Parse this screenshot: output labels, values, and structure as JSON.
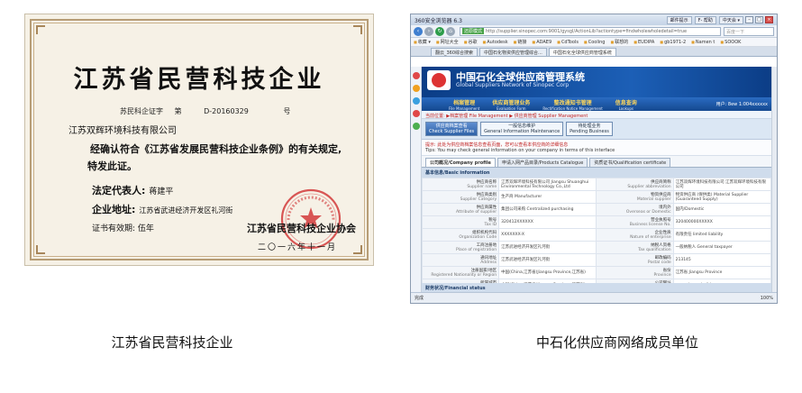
{
  "certificate": {
    "title": "江苏省民营科技企业",
    "number_prefix": "苏民科企证字",
    "number_di": "第",
    "number": "D-20160329",
    "number_suffix": "号",
    "company": "江苏双辉环境科技有限公司",
    "statement_line1": "经确认符合《江苏省发展民营科技企业条例》的有关规定,",
    "statement_line2": "特发此证。",
    "rep_label": "法定代表人:",
    "rep_value": "蒋建平",
    "addr_label": "企业地址:",
    "addr_value": "江苏省武进经济开发区礼河街",
    "valid_label": "证书有效期:",
    "valid_value": "伍年",
    "issuer": "江苏省民营科技企业协会",
    "date": "二〇一六年十一月"
  },
  "captions": {
    "left": "江苏省民营科技企业",
    "right": "中石化供应商网络成员单位"
  },
  "browser": {
    "window_title": "360安全浏览器 6.3",
    "title_badges": [
      "邮件提示",
      "F- 帮助",
      "中天会 ▾"
    ],
    "address_label": "还原模式",
    "url": "http://supplier.sinopec.com:9001/gysgl/ActionLib?actiontype=findwholewholedetail=true",
    "search_placeholder": "百度一下",
    "bookmarks": [
      "收藏 ▾",
      "网址大全",
      "谷歌",
      "Autodesk",
      "链接",
      "ADAE9",
      "CdTools",
      "Cooling",
      "联想的",
      "EUDIPA",
      "gb1971-2",
      "Namen t",
      "SOOOK"
    ],
    "tabs": [
      "翻云_360综合搜索",
      "中国石化物资供应管理综合...",
      "中国石化全球供应商管理系统"
    ],
    "site": {
      "title_cn": "中国石化全球供应商管理系统",
      "title_en": "Global Suppliers Network of Sinopec Corp",
      "menu": [
        {
          "cn": "档案管理",
          "en": "File Management"
        },
        {
          "cn": "供应商管理业务",
          "en": "Evaluation Form"
        },
        {
          "cn": "整改通知书管理",
          "en": "Rectification Notice Management"
        },
        {
          "cn": "信息查询",
          "en": "Lookups"
        }
      ],
      "user": "用户: 8ew 1:004xxxxxx",
      "breadcrumb": "当前位置: ▶档案管理 File Management ▶ 供应商管理 Supplier Management",
      "buttons": [
        {
          "cn": "供应商档案查看",
          "en": "Check Supplier Files",
          "primary": true
        },
        {
          "cn": "一般信息维护",
          "en": "General Information Maintenance",
          "primary": false
        },
        {
          "cn": "待处理业务",
          "en": "Pending Business",
          "primary": false
        }
      ],
      "tip": "提示: 此处为供应商档案信息查看页面，您可以查看本供应商的详细信息",
      "tip2": "Tips: You may check general information on your company in terms of this interface",
      "profile_tabs": [
        "公司概况/Company profile",
        "申请入网产品目录/Products Catalogue",
        "资质证书/Qualification certificate"
      ],
      "basic_info_header": "基本信息/Basic information",
      "rows": [
        {
          "l1": "供应商名称",
          "l1en": "Supplier name",
          "v1": "江苏双辉环境科技有限公司 Jiangsu Shuanghui Environmental Technology Co.,Ltd",
          "l2": "供应商简称",
          "l2en": "Supplier abbreviation",
          "v2": "江苏双辉环境科技有限公司 江苏双辉环境科技有限公司"
        },
        {
          "l1": "供应商类别",
          "l1en": "Supplier Category",
          "v1": "生产商 Manufacturer",
          "l2": "物资供应商",
          "l2en": "Material supplier",
          "v2": "物资供应商 (保供类) Material Supplier (Guaranteed Supply)"
        },
        {
          "l1": "供应商属性",
          "l1en": "Attribute of supplier",
          "v1": "集团公司采购 Centralized purchasing",
          "l2": "境内外",
          "l2en": "Overseas or Domestic",
          "v2": "国内/Domestic"
        },
        {
          "l1": "税号",
          "l1en": "Tax ID",
          "v1": "320412XXXXXX",
          "l2": "营业执照号",
          "l2en": "Business license No.",
          "v2": "320400000XXXXX"
        },
        {
          "l1": "组织机构代码",
          "l1en": "Organization Code",
          "v1": "XXXXXXX-X",
          "l2": "企业性质",
          "l2en": "Nature of enterprise",
          "v2": "有限责任 limited liability"
        },
        {
          "l1": "工商注册地",
          "l1en": "Place of registration",
          "v1": "江苏武进经济开发区礼河街",
          "l2": "纳税人资格",
          "l2en": "Tax qualification",
          "v2": "一般纳税人 General taxpayer"
        },
        {
          "l1": "通讯地址",
          "l1en": "Address",
          "v1": "江苏武进经济开发区礼河街",
          "l2": "邮政编码",
          "l2en": "Postal code",
          "v2": "213145"
        },
        {
          "l1": "注册国家/地区",
          "l1en": "Registered Nationality or Region",
          "v1": "中国(China,江苏省(Jiangsu Province,江苏省)",
          "l2": "省份",
          "l2en": "Province",
          "v2": "江苏省 Jiangsu Province"
        },
        {
          "l1": "所属城市",
          "l1en": "City",
          "v1": "中国(China,江苏省(Jiangsu Province,江苏省)",
          "l2": "公司网址",
          "l2en": "Company Website",
          "v2": "www.shuanghuihb.com"
        },
        {
          "l1": "可以提供外资企业",
          "l1en": "Is it capable of foreign trade business",
          "v1": "",
          "l2": "供应商编码",
          "l2en": "Supplier code",
          "v2": "XXXXXX"
        }
      ],
      "financial_header": "财务状况/Financial status"
    },
    "status_text": "完成",
    "status_right": "100%"
  },
  "colors": {
    "seal": "#d23a3a",
    "banner": "#0b3d86",
    "menu_text": "#ffd75a"
  }
}
